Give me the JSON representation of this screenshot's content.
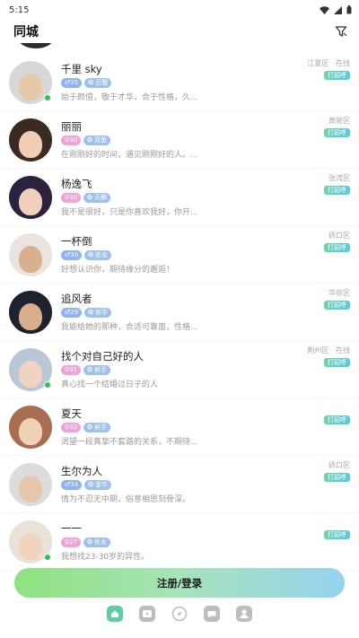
{
  "status_bar": {
    "time": "5:15"
  },
  "header": {
    "title": "同城"
  },
  "users": [
    {
      "name": "千里 sky",
      "gender": "male",
      "age": "♂35",
      "zodiac": "❂ 巨蟹",
      "bio": "始于颜值，敬于才华，合于性格，久...",
      "location": "江夏区 · 在线",
      "greet": "打招呼",
      "online": true,
      "colors": {
        "bg": "#d8d8d8",
        "face": "#e8c7a8"
      }
    },
    {
      "name": "丽丽",
      "gender": "female",
      "age": "♀30",
      "zodiac": "❂ 双鱼",
      "bio": "在刚刚好的时间，遇见刚刚好的人。...",
      "location": "黄陂区",
      "greet": "打招呼",
      "online": false,
      "colors": {
        "bg": "#3a2a22",
        "face": "#f0cdb4"
      }
    },
    {
      "name": "杨逸飞",
      "gender": "female",
      "age": "♀30",
      "zodiac": "❂ 天蝎",
      "bio": "我不是很好，只是你喜欢我好，你开...",
      "location": "张湾区",
      "greet": "打招呼",
      "online": false,
      "colors": {
        "bg": "#2b2240",
        "face": "#f1cfbd"
      }
    },
    {
      "name": "一杯倒",
      "gender": "male",
      "age": "♂30",
      "zodiac": "❂ 处女",
      "bio": "好想认识你，期待缘分的邂逅！",
      "location": "硚口区",
      "greet": "打招呼",
      "online": false,
      "colors": {
        "bg": "#e9e4df",
        "face": "#d8b08e"
      }
    },
    {
      "name": "追风者",
      "gender": "male",
      "age": "♂29",
      "zodiac": "❂ 射手",
      "bio": "我能给她的那种，合适可靠面，性格...",
      "location": "华容区",
      "greet": "打招呼",
      "online": false,
      "colors": {
        "bg": "#1e2230",
        "face": "#d9ae8c"
      }
    },
    {
      "name": "找个对自己好的人",
      "gender": "female",
      "age": "♀31",
      "zodiac": "❂ 射手",
      "bio": "真心找一个结婚过日子的人",
      "location": "荆州区 · 在线",
      "greet": "打招呼",
      "online": true,
      "colors": {
        "bg": "#b9c8d6",
        "face": "#f2d2c2"
      }
    },
    {
      "name": "夏天",
      "gender": "female",
      "age": "♀32",
      "zodiac": "❂ 射手",
      "bio": "渴望一段真挚不套路的关系，不期待...",
      "location": "",
      "greet": "打招呼",
      "online": false,
      "colors": {
        "bg": "#a86e52",
        "face": "#f0d2b8"
      }
    },
    {
      "name": "生尔为人",
      "gender": "male",
      "age": "♂34",
      "zodiac": "❂ 金牛",
      "bio": "情为不忍无中期，俗意相思刻骨深。",
      "location": "硚口区",
      "greet": "打招呼",
      "online": false,
      "colors": {
        "bg": "#dcdcdc",
        "face": "#e8c6ac"
      }
    },
    {
      "name": "一一",
      "gender": "female",
      "age": "♀27",
      "zodiac": "❂ 处女",
      "bio": "我想找23-30岁的异性。",
      "location": "",
      "greet": "打招呼",
      "online": true,
      "colors": {
        "bg": "#e8e2d8",
        "face": "#f1d4bd"
      }
    }
  ],
  "login_button": {
    "label": "注册/登录"
  },
  "bottom_nav": [
    {
      "icon": "home-icon",
      "color": "#5ccfa2"
    },
    {
      "icon": "video-icon",
      "color": "#bdbdbd"
    },
    {
      "icon": "compass-icon",
      "color": "#bdbdbd"
    },
    {
      "icon": "message-icon",
      "color": "#bdbdbd"
    },
    {
      "icon": "profile-icon",
      "color": "#bdbdbd"
    }
  ]
}
